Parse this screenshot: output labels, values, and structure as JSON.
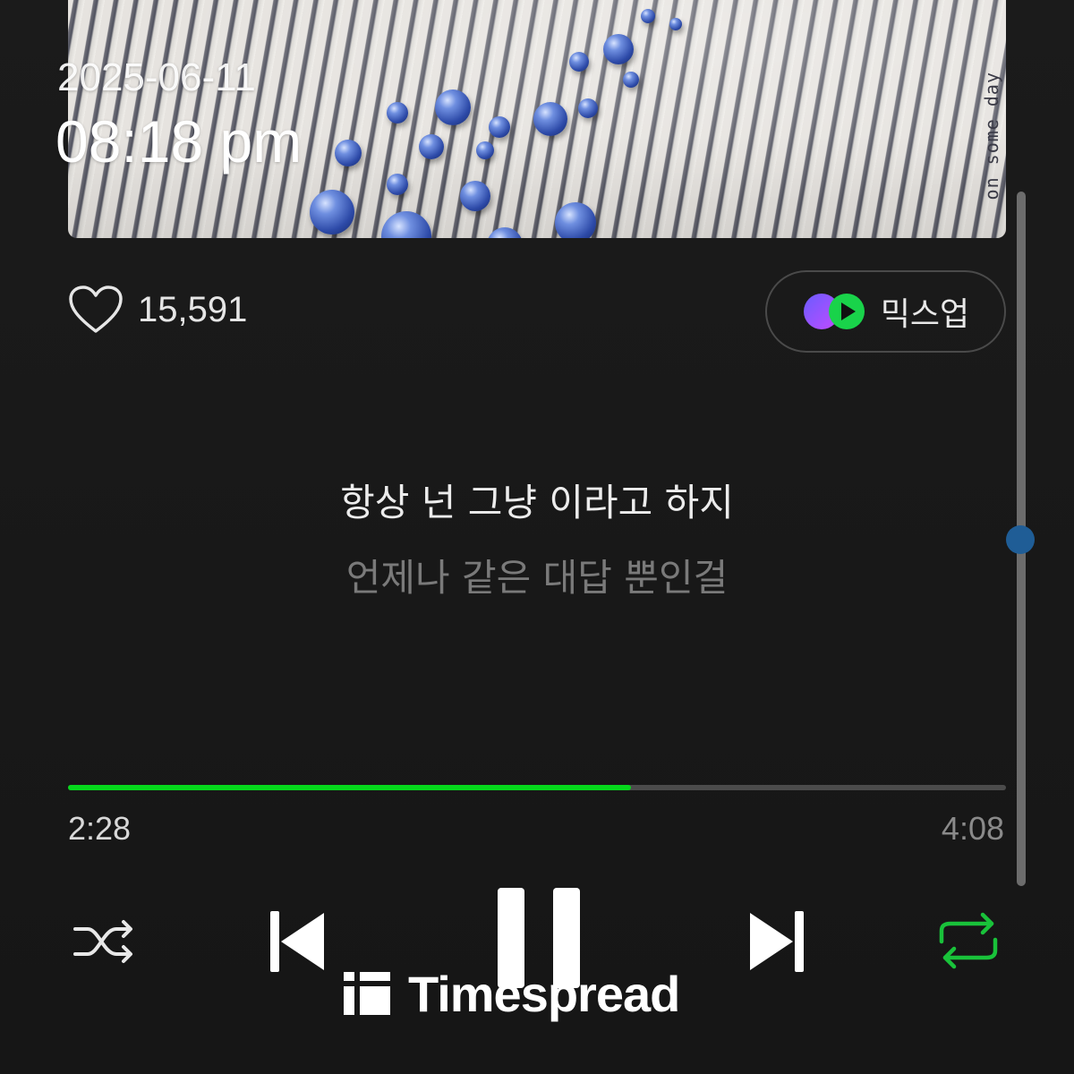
{
  "overlay": {
    "date": "2025-06-11",
    "time": "08:18 pm"
  },
  "album": {
    "side_text": "on some day"
  },
  "like": {
    "icon": "heart-outline-icon",
    "count": "15,591"
  },
  "mixup": {
    "icon": "mixup-icon",
    "label": "믹스업"
  },
  "lyrics": {
    "current": "항상 넌 그냥 이라고 하지",
    "next": "언제나 같은 대답 뿐인걸"
  },
  "playback": {
    "elapsed": "2:28",
    "duration": "4:08",
    "progress_fraction": 0.6,
    "accent_color": "#06d81c",
    "shuffle_icon": "shuffle-icon",
    "previous_icon": "skip-previous-icon",
    "pause_icon": "pause-icon",
    "next_icon": "skip-next-icon",
    "repeat_icon": "repeat-icon",
    "repeat_active": true
  },
  "watermark": {
    "text": "Timespread"
  }
}
